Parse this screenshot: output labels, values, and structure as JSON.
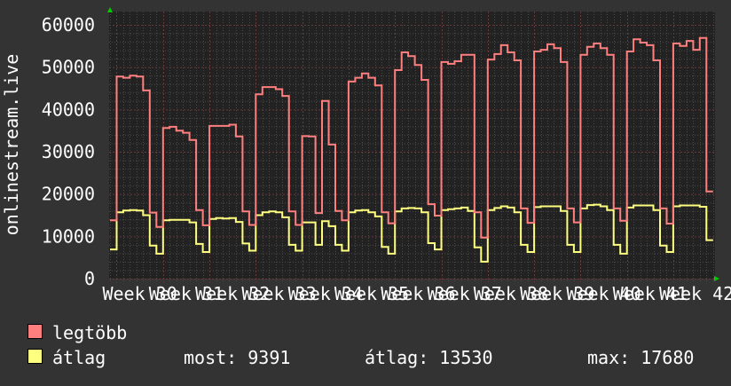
{
  "chart_data": {
    "type": "line",
    "title": "",
    "ylabel": "onlinestream.live",
    "xlabel": "",
    "ylim": [
      0,
      60000
    ],
    "yticks": [
      "0",
      "10000",
      "20000",
      "30000",
      "40000",
      "50000",
      "60000"
    ],
    "ytick_values": [
      0,
      10000,
      20000,
      30000,
      40000,
      50000,
      60000
    ],
    "xtick_labels": [
      "Week 30",
      "Week 31",
      "Week 32",
      "Week 33",
      "Week 34",
      "Week 35",
      "Week 36",
      "Week 37",
      "Week 38",
      "Week 39",
      "Week 40",
      "Week 41",
      "Week 42"
    ],
    "x_unit": "day",
    "grid": true,
    "series": [
      {
        "name": "legtöbb",
        "color": "#ff7f7f",
        "values": [
          13800,
          47800,
          47500,
          48000,
          47800,
          44500,
          15600,
          12200,
          35600,
          35900,
          35000,
          34500,
          32800,
          16200,
          12600,
          36100,
          36100,
          36100,
          36400,
          33600,
          15900,
          12700,
          43600,
          45300,
          45300,
          44800,
          43200,
          15900,
          12700,
          33700,
          33600,
          15500,
          42000,
          31700,
          16000,
          13800,
          46600,
          47500,
          48500,
          47500,
          45700,
          15700,
          13100,
          49300,
          53500,
          52600,
          50500,
          47000,
          17600,
          14900,
          51200,
          50800,
          51400,
          52900,
          52900,
          15700,
          9700,
          51800,
          53100,
          55200,
          53500,
          51600,
          16600,
          13200,
          53700,
          54100,
          55400,
          54500,
          51200,
          16600,
          13300,
          52900,
          54800,
          55600,
          54500,
          52900,
          16600,
          13700,
          53700,
          56600,
          55800,
          55200,
          51600,
          16600,
          13000,
          55600,
          55000,
          56200,
          54100,
          56900,
          20600
        ]
      },
      {
        "name": "átlag",
        "color": "#ffff7f",
        "values": [
          6900,
          15700,
          16100,
          16200,
          16100,
          15000,
          7800,
          5900,
          13800,
          13900,
          13900,
          13900,
          13300,
          8200,
          6300,
          14100,
          14300,
          14200,
          14300,
          13400,
          8300,
          6600,
          15000,
          15700,
          15900,
          15700,
          14500,
          8000,
          6600,
          13300,
          13300,
          8000,
          13600,
          12400,
          8000,
          6600,
          15700,
          16100,
          16200,
          15700,
          14700,
          7500,
          5900,
          15900,
          16600,
          16700,
          16600,
          15700,
          8400,
          6900,
          16200,
          16400,
          16600,
          16800,
          16000,
          7400,
          4000,
          16200,
          16700,
          17100,
          16800,
          15700,
          8000,
          6300,
          16900,
          17100,
          17100,
          17100,
          16000,
          8000,
          6300,
          16600,
          17400,
          17500,
          17100,
          16200,
          8000,
          5900,
          16800,
          17300,
          17300,
          17300,
          16200,
          7800,
          6300,
          17100,
          17300,
          17300,
          17300,
          17000,
          9100
        ]
      }
    ],
    "legend": {
      "placement": "bottom-left",
      "items": [
        {
          "label": "legtöbb",
          "color": "#ff7f7f"
        },
        {
          "label": "átlag",
          "color": "#ffff7f"
        }
      ],
      "stats": {
        "most": "most: 9391",
        "atlag": "átlag: 13530",
        "max": "max: 17680"
      }
    }
  }
}
